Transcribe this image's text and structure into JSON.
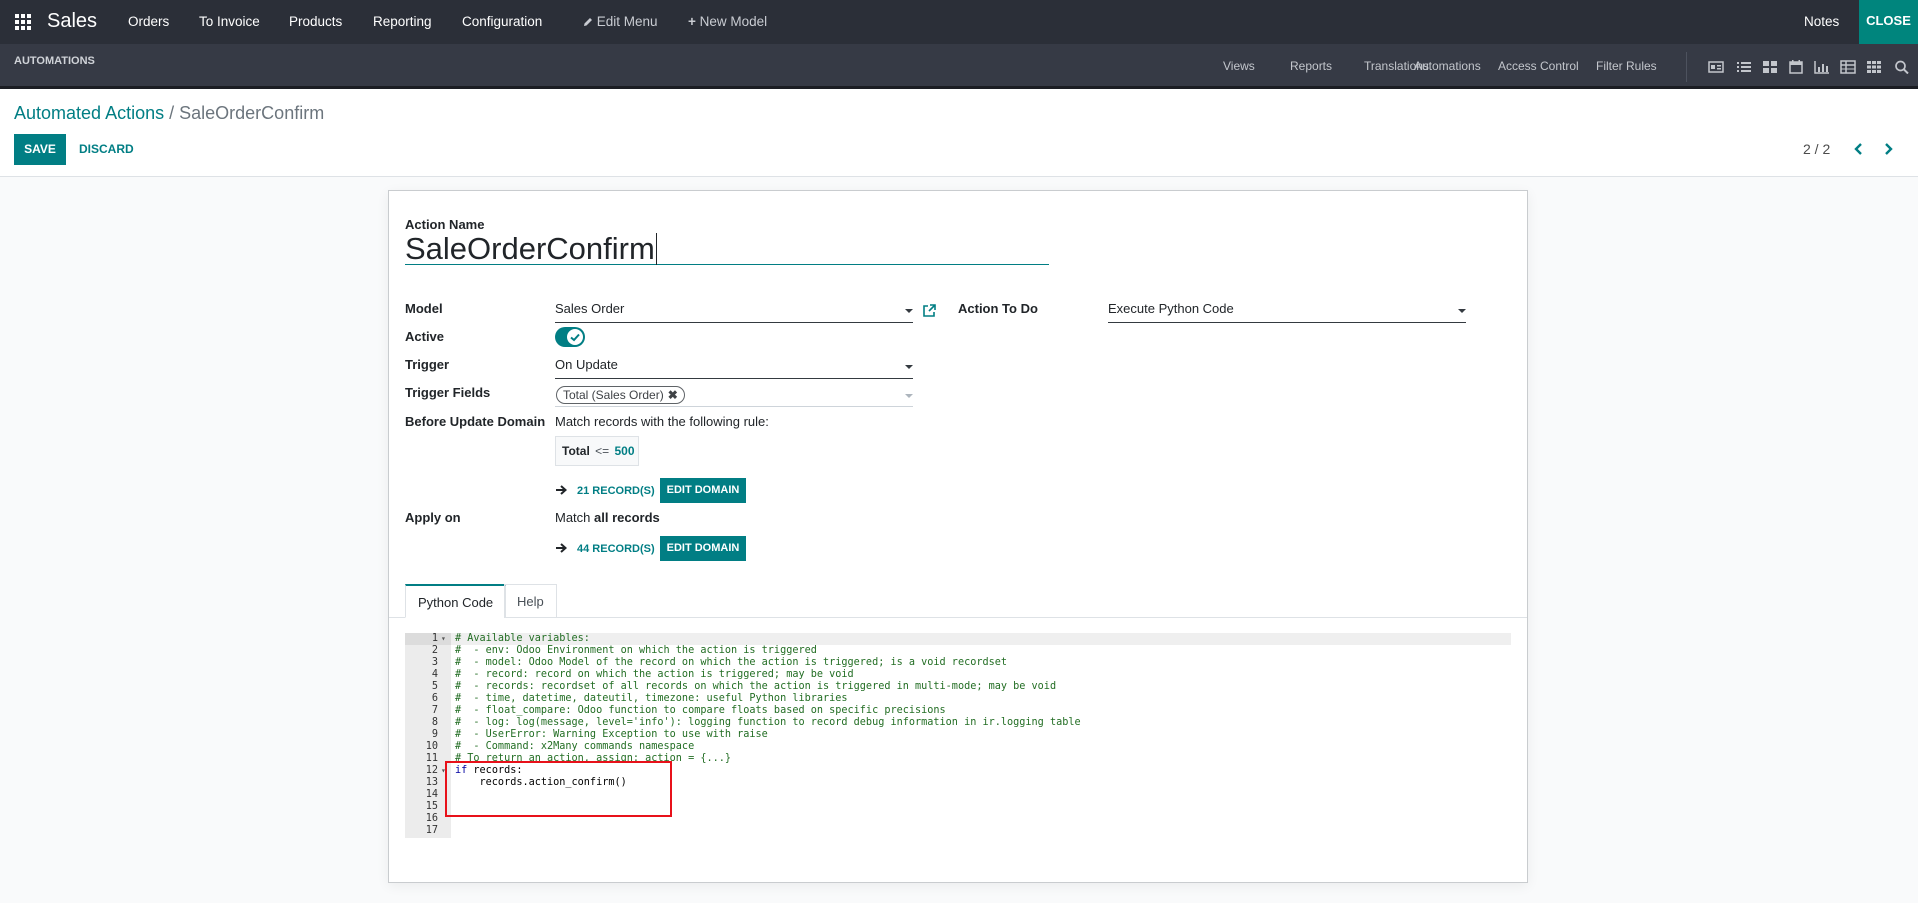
{
  "navbar": {
    "app_name": "Sales",
    "menu": [
      "Orders",
      "To Invoice",
      "Products",
      "Reporting",
      "Configuration"
    ],
    "edit_menu": "Edit Menu",
    "new_model": "New Model",
    "notes": "Notes",
    "close": "CLOSE"
  },
  "studio": {
    "title": "AUTOMATIONS",
    "links": [
      "Views",
      "Reports",
      "Translations",
      "Automations",
      "Access Control",
      "Filter Rules"
    ],
    "view_icons": [
      "form-view-icon",
      "list-view-icon",
      "kanban-view-icon",
      "calendar-view-icon",
      "graph-view-icon",
      "pivot-view-icon",
      "grid-view-icon",
      "search-view-icon"
    ]
  },
  "control": {
    "breadcrumb_parent": "Automated Actions",
    "breadcrumb_sep": "/",
    "breadcrumb_current": "SaleOrderConfirm",
    "save": "SAVE",
    "discard": "DISCARD",
    "pager": "2 / 2"
  },
  "form": {
    "action_name_label": "Action Name",
    "action_name_value": "SaleOrderConfirm",
    "model_label": "Model",
    "model_value": "Sales Order",
    "active_label": "Active",
    "active_value": true,
    "trigger_label": "Trigger",
    "trigger_value": "On Update",
    "trigger_fields_label": "Trigger Fields",
    "trigger_field_tag": "Total (Sales Order)",
    "before_domain_label": "Before Update Domain",
    "before_domain_text": "Match records with the following rule:",
    "domain_field": "Total",
    "domain_operator": "<=",
    "domain_value": "500",
    "before_records": "21 RECORD(S)",
    "edit_domain": "EDIT DOMAIN",
    "apply_on_label": "Apply on",
    "apply_on_prefix": "Match ",
    "apply_on_bold": "all records",
    "apply_records": "44 RECORD(S)",
    "action_to_do_label": "Action To Do",
    "action_to_do_value": "Execute Python Code"
  },
  "tabs": [
    "Python Code",
    "Help"
  ],
  "code": {
    "lines": [
      "# Available variables:",
      "#  - env: Odoo Environment on which the action is triggered",
      "#  - model: Odoo Model of the record on which the action is triggered; is a void recordset",
      "#  - record: record on which the action is triggered; may be void",
      "#  - records: recordset of all records on which the action is triggered in multi-mode; may be void",
      "#  - time, datetime, dateutil, timezone: useful Python libraries",
      "#  - float_compare: Odoo function to compare floats based on specific precisions",
      "#  - log: log(message, level='info'): logging function to record debug information in ir.logging table",
      "#  - UserError: Warning Exception to use with raise",
      "#  - Command: x2Many commands namespace",
      "# To return an action, assign: action = {...}",
      "",
      "    records.action_confirm()",
      "",
      "",
      "",
      ""
    ],
    "line12_keyword": "if",
    "line12_rest": " records:"
  }
}
